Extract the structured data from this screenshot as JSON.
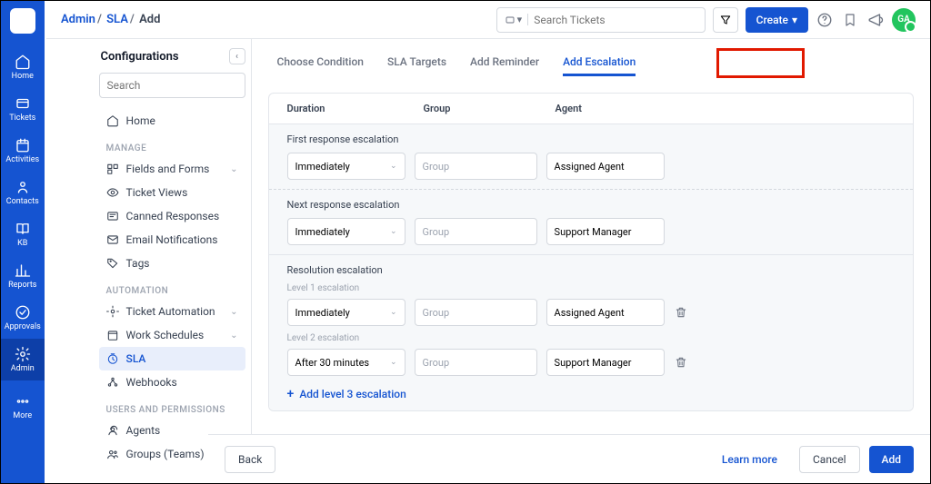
{
  "breadcrumb": {
    "seg1": "Admin",
    "seg2": "SLA",
    "seg3": "Add"
  },
  "topbar": {
    "search_placeholder": "Search Tickets",
    "create": "Create",
    "avatar": "GA"
  },
  "leftnav": {
    "home": "Home",
    "tickets": "Tickets",
    "activities": "Activities",
    "contacts": "Contacts",
    "kb": "KB",
    "reports": "Reports",
    "approvals": "Approvals",
    "admin": "Admin",
    "more": "More"
  },
  "sidebar": {
    "title": "Configurations",
    "search_placeholder": "Search",
    "home": "Home",
    "grp_manage": "MANAGE",
    "fields": "Fields and Forms",
    "ticket_views": "Ticket Views",
    "canned": "Canned Responses",
    "email_notif": "Email Notifications",
    "tags": "Tags",
    "grp_auto": "AUTOMATION",
    "ticket_auto": "Ticket Automation",
    "work_sched": "Work Schedules",
    "sla": "SLA",
    "webhooks": "Webhooks",
    "grp_users": "USERS AND PERMISSIONS",
    "agents": "Agents",
    "groups": "Groups (Teams)"
  },
  "tabs": {
    "cond": "Choose Condition",
    "targets": "SLA Targets",
    "reminder": "Add Reminder",
    "escalation": "Add Escalation"
  },
  "panel": {
    "h_duration": "Duration",
    "h_group": "Group",
    "h_agent": "Agent",
    "first": {
      "title": "First response escalation",
      "dur": "Immediately",
      "grp": "Group",
      "agent": "Assigned Agent"
    },
    "next": {
      "title": "Next response escalation",
      "dur": "Immediately",
      "grp": "Group",
      "agent": "Support Manager"
    },
    "res": {
      "title": "Resolution escalation",
      "l1": {
        "label": "Level 1 escalation",
        "dur": "Immediately",
        "grp": "Group",
        "agent": "Assigned Agent"
      },
      "l2": {
        "label": "Level 2 escalation",
        "dur": "After 30 minutes",
        "grp": "Group",
        "agent": "Support Manager"
      },
      "addlink": "Add level 3 escalation"
    }
  },
  "footer": {
    "back": "Back",
    "learn": "Learn more",
    "cancel": "Cancel",
    "add": "Add"
  }
}
